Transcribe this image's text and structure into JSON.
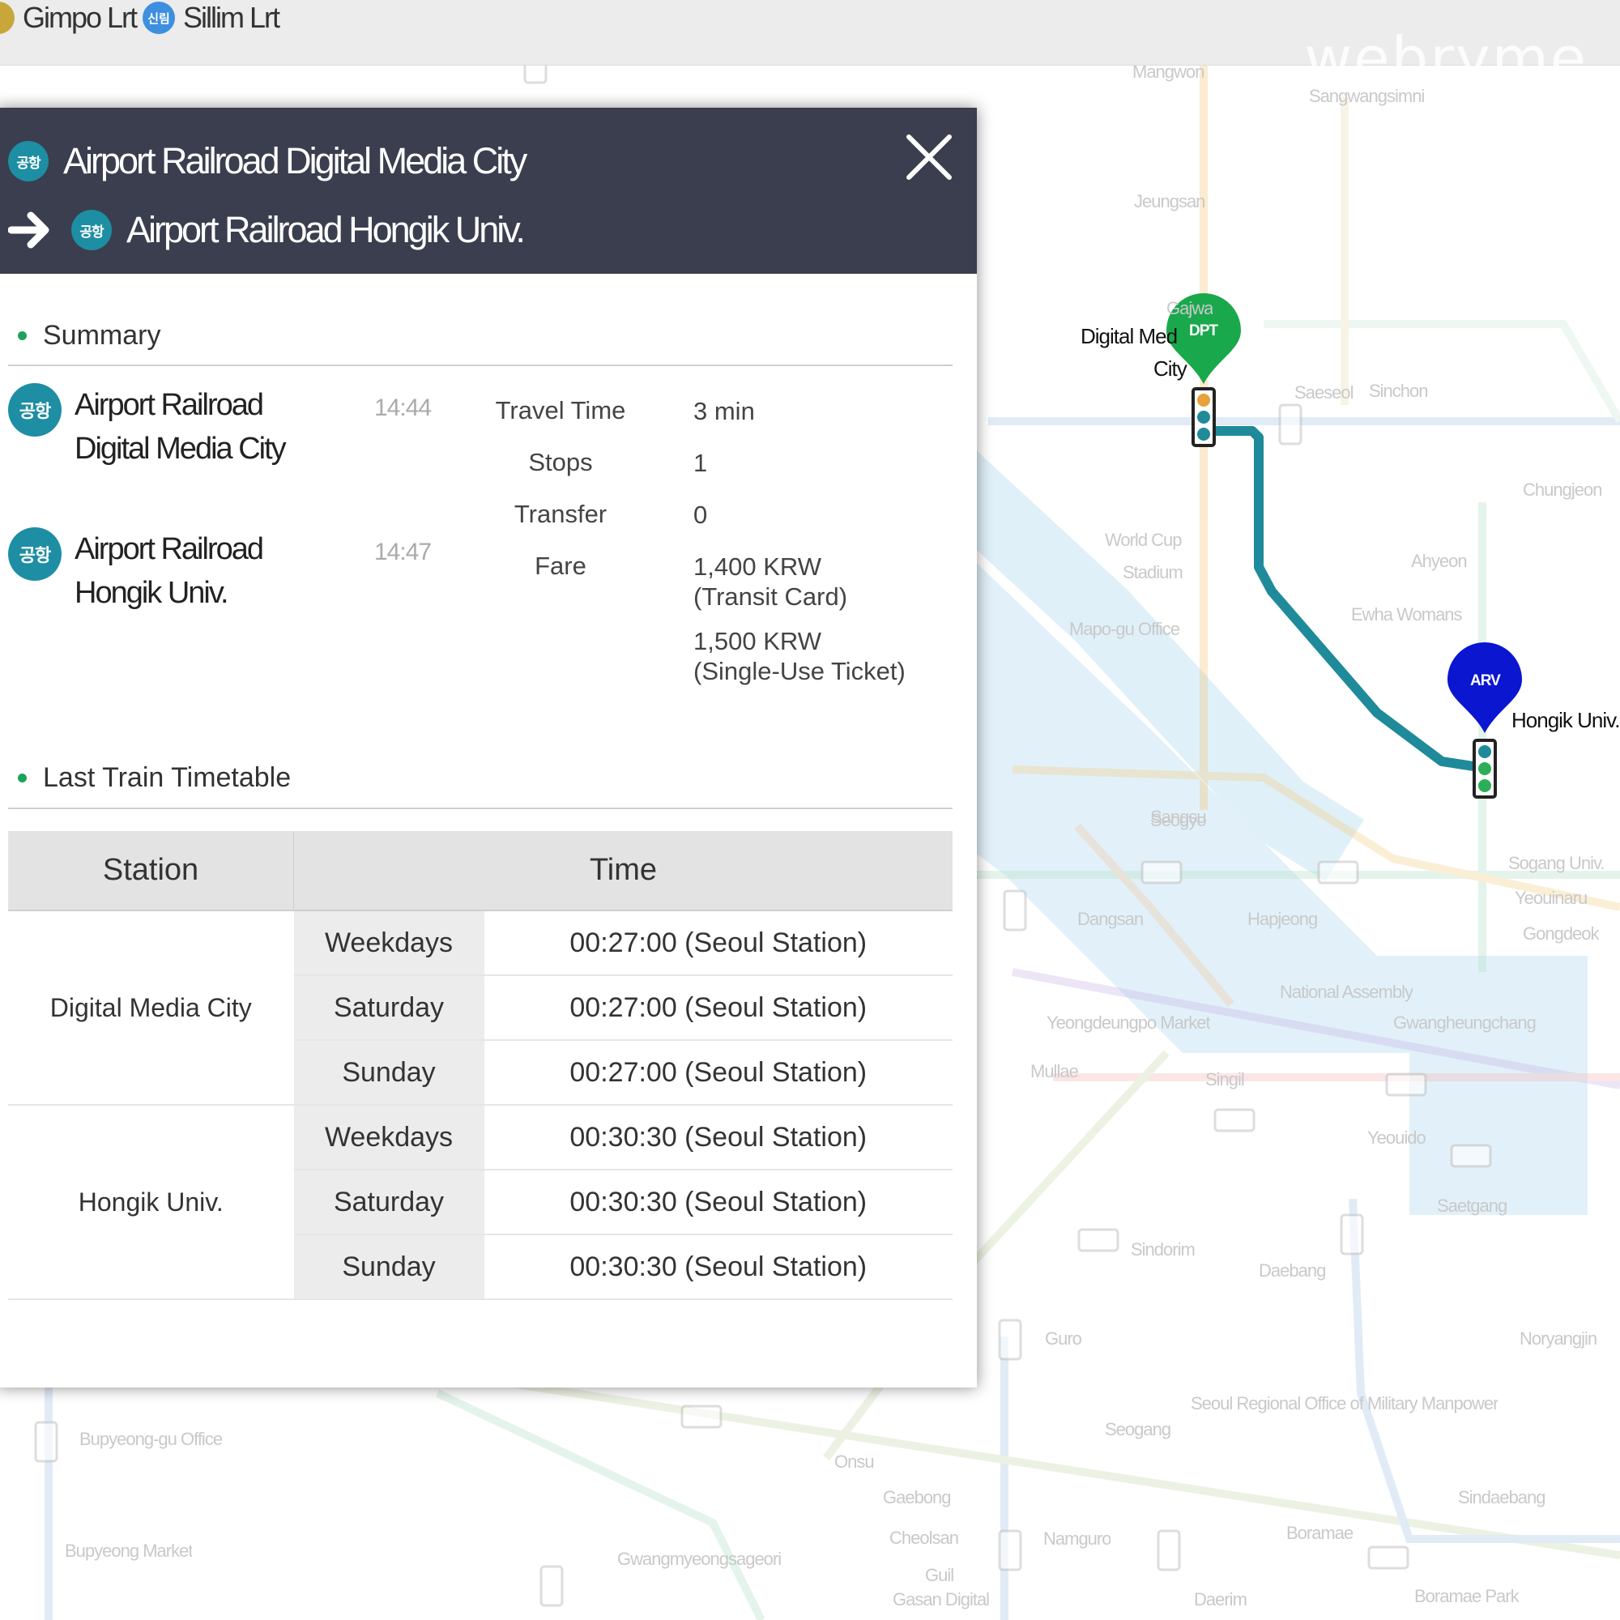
{
  "top_legend": [
    {
      "label": "Gimpo Lrt",
      "badge": "",
      "color": "#c8a63a"
    },
    {
      "label": "Sillim Lrt",
      "badge": "신림",
      "color": "#3d8fe0"
    }
  ],
  "watermark": "webryme",
  "panel": {
    "origin": {
      "station": "Airport Railroad Digital Media City",
      "badge": "공항"
    },
    "destination": {
      "station": "Airport Railroad Hongik Univ.",
      "badge": "공항"
    },
    "summary": {
      "title": "Summary",
      "stations": [
        {
          "line1": "Airport Railroad",
          "line2": "Digital Media City",
          "time": "14:44",
          "badge": "공항"
        },
        {
          "line1": "Airport Railroad",
          "line2": "Hongik Univ.",
          "time": "14:47",
          "badge": "공항"
        }
      ],
      "info": [
        {
          "label": "Travel Time",
          "value": "3 min"
        },
        {
          "label": "Stops",
          "value": "1"
        },
        {
          "label": "Transfer",
          "value": "0"
        },
        {
          "label": "Fare",
          "value": "1,400 KRW"
        }
      ],
      "fare_lines": [
        "1,400 KRW",
        "(Transit Card)",
        "1,500 KRW",
        "(Single-Use Ticket)"
      ]
    },
    "timetable": {
      "title": "Last Train Timetable",
      "headers": [
        "Station",
        "Time"
      ],
      "rows": [
        {
          "station": "Digital Media City",
          "entries": [
            {
              "day": "Weekdays",
              "time": "00:27:00 (Seoul Station)"
            },
            {
              "day": "Saturday",
              "time": "00:27:00 (Seoul Station)"
            },
            {
              "day": "Sunday",
              "time": "00:27:00 (Seoul Station)"
            }
          ]
        },
        {
          "station": "Hongik Univ.",
          "entries": [
            {
              "day": "Weekdays",
              "time": "00:30:30 (Seoul Station)"
            },
            {
              "day": "Saturday",
              "time": "00:30:30 (Seoul Station)"
            },
            {
              "day": "Sunday",
              "time": "00:30:30 (Seoul Station)"
            }
          ]
        }
      ]
    }
  },
  "map": {
    "departure_pin": "DPT",
    "arrival_pin": "ARV",
    "departure_label_1": "Digital Med",
    "departure_label_2": "City",
    "arrival_label": "Hongik Univ.",
    "route_color": "#1f8a9a",
    "faded_labels": [
      "Sinchon",
      "Chungjeon",
      "Ahyeon",
      "Ewha Womans",
      "World Cup",
      "Stadium",
      "Mapo-gu Office",
      "Sangsu",
      "Seogyo",
      "Hapjeong",
      "Dangsan",
      "National Assembly",
      "Gwangheungchang",
      "Yeouinaru",
      "Yeouido",
      "Singil",
      "Mullae",
      "Yeongdeungpo Market",
      "Sindorim",
      "Daebang",
      "Saetgang",
      "Noryangjin",
      "Guro",
      "Seoul Regional Office of Military Manpower",
      "Bupyeong-gu Office",
      "Bupyeong Market",
      "Sindaebang",
      "Boramae",
      "Daerim",
      "Gasan Digital",
      "Guil",
      "Namguro",
      "Sogang Univ.",
      "Gwangmyeongsageori",
      "Cheolsan",
      "Boramae Park",
      "Seogang",
      "Gongdeok",
      "Gaebong",
      "Onsu",
      "Sangwangsimni",
      "Mangwon",
      "Jeungsan",
      "Saeseol",
      "Gajwa"
    ]
  }
}
